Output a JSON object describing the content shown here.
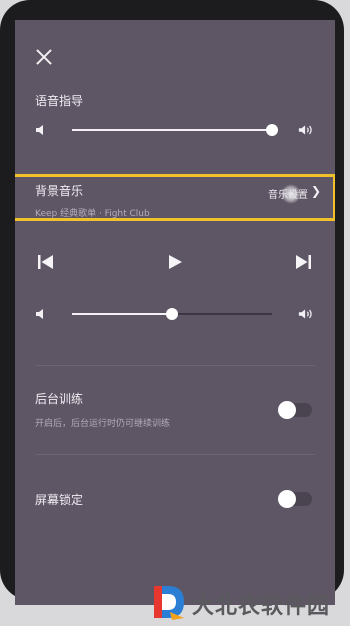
{
  "voice_guide": {
    "title": "语音指导",
    "volume": 1.0
  },
  "background_music": {
    "title": "背景音乐",
    "settings_label": "音乐设置",
    "playlist": "Keep 经典歌单 · Fight Club",
    "volume": 0.5
  },
  "playback": {
    "prev_icon": "skip-previous-icon",
    "play_icon": "play-icon",
    "next_icon": "skip-next-icon"
  },
  "background_training": {
    "title": "后台训练",
    "description": "开启后，后台运行时仍可继续训练",
    "enabled": false
  },
  "screen_lock": {
    "title": "屏幕锁定",
    "enabled": false
  },
  "colors": {
    "panel": "#5e5565",
    "highlight": "#f0c12b"
  },
  "watermark": {
    "text": "大北农软件园"
  }
}
